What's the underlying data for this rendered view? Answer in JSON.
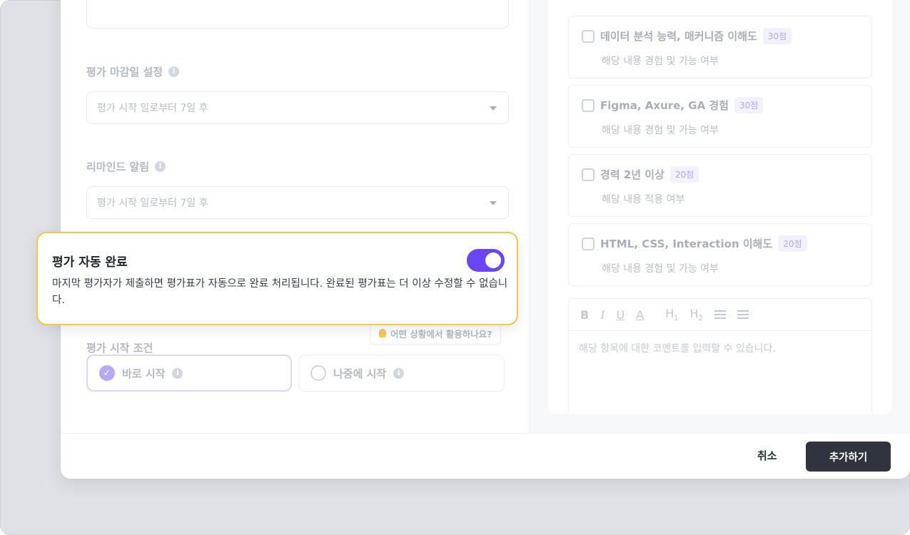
{
  "form": {
    "deadline": {
      "label": "평가 마감일 설정",
      "value": "평가 시작 일로부터 7일 후"
    },
    "reminder": {
      "label": "리마인드 알림",
      "value": "평가 시작 일로부터 7일 후"
    },
    "auto_complete": {
      "title": "평가 자동 완료",
      "description": "마지막 평가자가 제출하면 평가표가 자동으로 완료 처리됩니다. 완료된 평가표는 더 이상 수정할 수 없습니다.",
      "enabled": true
    },
    "start_condition": {
      "label": "평가 시작 조건",
      "hint": "어떤 상황에서 활용하나요?",
      "options": [
        {
          "label": "바로 시작",
          "selected": true
        },
        {
          "label": "나중에 시작",
          "selected": false
        }
      ]
    }
  },
  "criteria": [
    {
      "title": "데이터 분석 능력, 매커니즘 이해도",
      "score": "30점",
      "desc": "해당 내용 경험 및 가능 여부"
    },
    {
      "title": "Figma, Axure, GA 경험",
      "score": "30점",
      "desc": "해당 내용 경험 및 가능 여부"
    },
    {
      "title": "경력 2년 이상",
      "score": "20점",
      "desc": "해당 내용 적용 여부"
    },
    {
      "title": "HTML, CSS, Interaction 이해도",
      "score": "20점",
      "desc": "해당 내용 경험 및 가능 여부"
    }
  ],
  "editor": {
    "toolbar": [
      "bold-icon",
      "italic-icon",
      "underline-icon",
      "text-color-icon",
      "heading-1-icon",
      "heading-2-icon",
      "ordered-list-icon",
      "bullet-list-icon"
    ],
    "placeholder": "해당 항목에 대한 코멘트를 입력할 수 있습니다."
  },
  "footer": {
    "cancel_label": "취소",
    "submit_label": "추가하기"
  },
  "colors": {
    "accent": "#6a45f5",
    "highlight_border": "#f5c842",
    "primary_button": "#30343d"
  }
}
